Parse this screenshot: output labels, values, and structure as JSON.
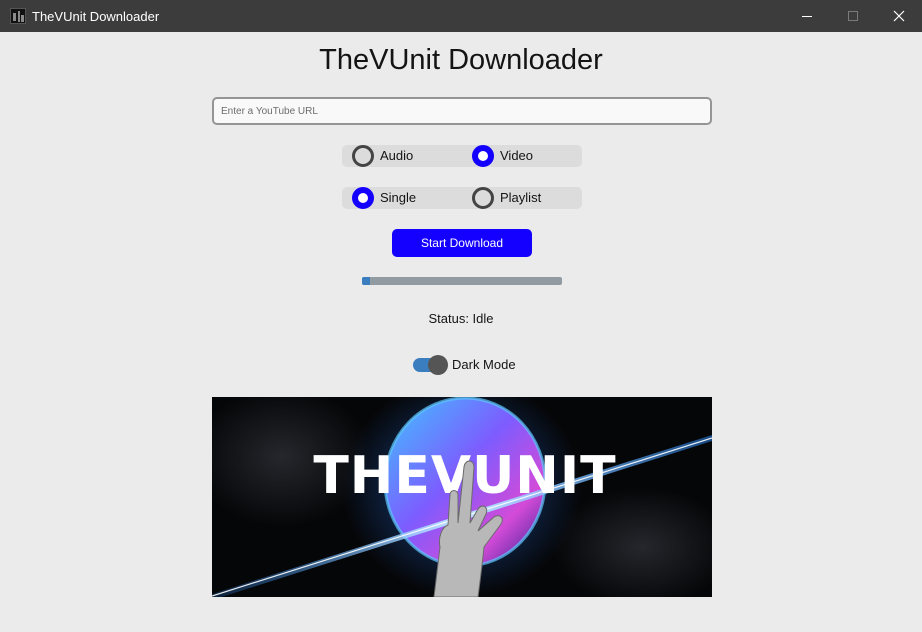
{
  "window": {
    "title": "TheVUnit Downloader",
    "icons": {
      "app": "app-icon",
      "minimize": "minimize-icon",
      "maximize": "maximize-icon",
      "close": "close-icon"
    }
  },
  "main": {
    "heading": "TheVUnit Downloader",
    "url_input": {
      "value": "",
      "placeholder": "Enter a YouTube URL"
    },
    "media_type": {
      "options": [
        {
          "label": "Audio",
          "checked": false
        },
        {
          "label": "Video",
          "checked": true
        }
      ]
    },
    "download_mode": {
      "options": [
        {
          "label": "Single",
          "checked": true
        },
        {
          "label": "Playlist",
          "checked": false
        }
      ]
    },
    "start_button": "Start Download",
    "progress": {
      "fraction": 0.04
    },
    "status": "Status: Idle",
    "dark_mode": {
      "label": "Dark Mode",
      "on": true
    },
    "banner": {
      "logo_text": "THEVUNIT"
    }
  },
  "colors": {
    "accent": "#1400ff",
    "progress_fill": "#3a7ebf",
    "toggle_track": "#3a7ebf",
    "titlebar": "#3c3c3c",
    "window_bg": "#ebebeb"
  }
}
